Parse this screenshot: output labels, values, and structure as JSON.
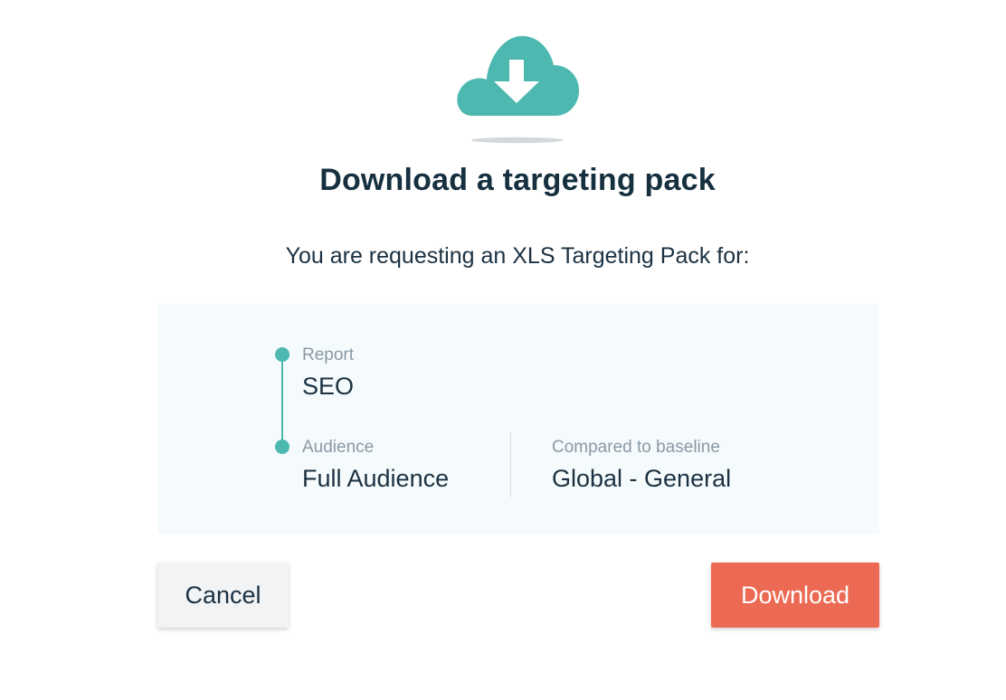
{
  "dialog": {
    "icon": "cloud-download-icon",
    "title": "Download a targeting pack",
    "subtitle": "You are requesting an XLS Targeting Pack for:"
  },
  "details": {
    "report": {
      "label": "Report",
      "value": "SEO"
    },
    "audience": {
      "label": "Audience",
      "value": "Full Audience"
    },
    "baseline": {
      "label": "Compared to baseline",
      "value": "Global - General"
    }
  },
  "actions": {
    "cancel_label": "Cancel",
    "download_label": "Download"
  },
  "colors": {
    "accent_teal": "#4db8b0",
    "download_button": "#ec6a54",
    "panel_background": "#f5fafc",
    "title_text": "#16303f"
  }
}
